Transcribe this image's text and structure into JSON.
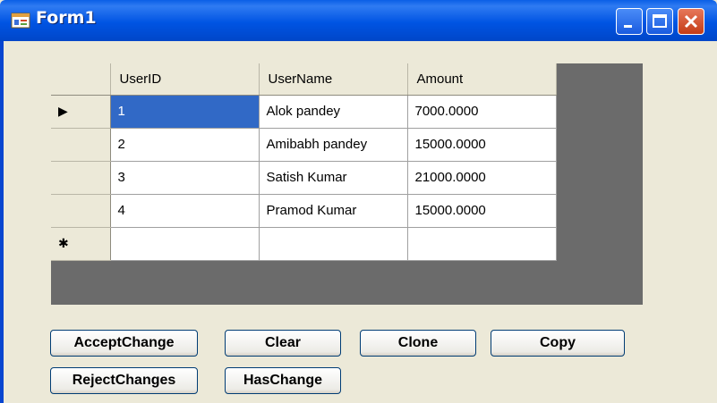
{
  "window": {
    "title": "Form1",
    "icon": "form-app-icon",
    "controls": [
      "minimize-icon",
      "maximize-icon",
      "close-icon"
    ],
    "title_color": "#0054e3"
  },
  "grid": {
    "columns": [
      "UserID",
      "UserName",
      "Amount"
    ],
    "rows": [
      {
        "indicator": "▶",
        "cells": [
          "1",
          "Alok pandey",
          "7000.0000"
        ],
        "selected": true
      },
      {
        "indicator": "",
        "cells": [
          "2",
          "Amibabh pandey",
          "15000.0000"
        ]
      },
      {
        "indicator": "",
        "cells": [
          "3",
          "Satish Kumar",
          "21000.0000"
        ]
      },
      {
        "indicator": "",
        "cells": [
          "4",
          "Pramod Kumar",
          "15000.0000"
        ]
      }
    ],
    "new_row_indicator": "✱",
    "selection_color": "#3169c6"
  },
  "buttons": {
    "accept": "AcceptChange",
    "clear": "Clear",
    "clone": "Clone",
    "copy": "Copy",
    "reject": "RejectChanges",
    "has_change": "HasChange"
  }
}
